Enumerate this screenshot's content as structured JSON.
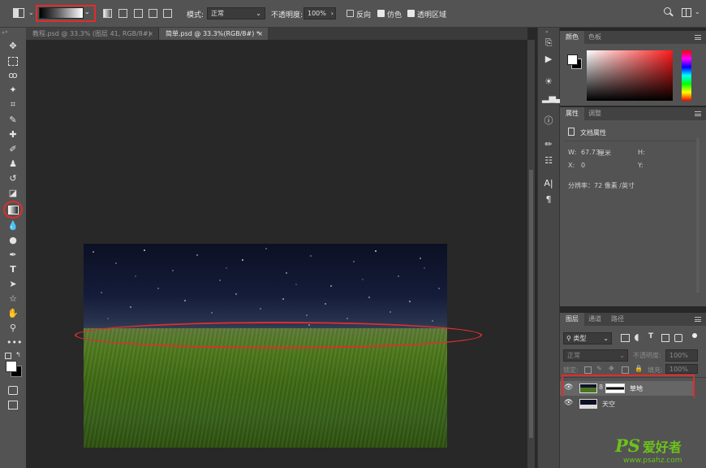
{
  "options_bar": {
    "mode_label": "模式:",
    "mode_value": "正常",
    "opacity_label": "不透明度:",
    "opacity_value": "100%",
    "reverse_label": "反向",
    "dither_label": "仿色",
    "transparency_label": "透明区域",
    "reverse_checked": false,
    "dither_checked": true,
    "transparency_checked": true
  },
  "tabs": [
    {
      "label": "教程.psd @ 33.3% (图层 41, RGB/8#)",
      "close": "×"
    },
    {
      "label": "简单.psd @ 33.3%(RGB/8#) *",
      "close": "×"
    }
  ],
  "color_panel": {
    "tabs": [
      "颜色",
      "色板"
    ]
  },
  "properties_panel": {
    "tabs": [
      "属性",
      "调整"
    ],
    "doc_title": "文档属性",
    "w_label": "W:",
    "w_value": "67.73",
    "w_unit": "厘米",
    "h_label": "H:",
    "x_label": "X:",
    "x_value": "0",
    "y_label": "Y:",
    "resolution_text": "分辨率：72 像素 /英寸"
  },
  "layers_panel": {
    "tabs": [
      "图层",
      "通道",
      "路径"
    ],
    "filter_value": "类型",
    "blend_value": "正常",
    "opacity_label": "不透明度:",
    "opacity_value": "100%",
    "lock_label": "锁定:",
    "fill_label": "填充:",
    "fill_value": "100%",
    "layers": [
      {
        "name": "草地",
        "visible": true
      },
      {
        "name": "天空",
        "visible": true
      }
    ]
  },
  "watermark": {
    "brand_ps": "PS",
    "brand_cn": "爱好者",
    "url": "www.psahz.com"
  },
  "colors": {
    "accent_red": "#e02d2d",
    "ui_dark": "#535353",
    "canvas_bg": "#282828"
  }
}
